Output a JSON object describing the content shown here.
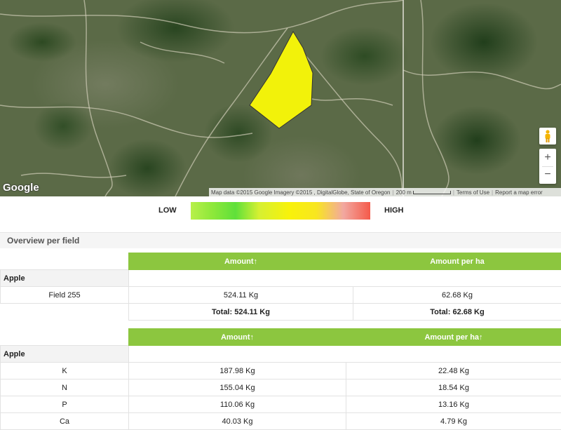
{
  "map": {
    "logo": "Google",
    "attribution": {
      "data": "Map data ©2015 Google Imagery ©2015 , DigitalGlobe, State of Oregon",
      "scale": "200 m",
      "terms": "Terms of Use",
      "report": "Report a map error"
    },
    "controls": {
      "zoom_in": "+",
      "zoom_out": "−"
    },
    "field_color": "#f2f20a"
  },
  "legend": {
    "low": "LOW",
    "high": "HIGH"
  },
  "section": {
    "title": "Overview per field"
  },
  "table1": {
    "headers": [
      "Amount↑",
      "Amount per ha"
    ],
    "group": "Apple",
    "rows": [
      {
        "name": "Field 255",
        "amount": "524.11 Kg",
        "per_ha": "62.68 Kg"
      }
    ],
    "total": {
      "amount": "Total: 524.11 Kg",
      "per_ha": "Total: 62.68 Kg"
    }
  },
  "table2": {
    "headers": [
      "Amount↑",
      "Amount per ha↑"
    ],
    "group": "Apple",
    "rows": [
      {
        "name": "K",
        "amount": "187.98 Kg",
        "per_ha": "22.48 Kg"
      },
      {
        "name": "N",
        "amount": "155.04 Kg",
        "per_ha": "18.54 Kg"
      },
      {
        "name": "P",
        "amount": "110.06 Kg",
        "per_ha": "13.16 Kg"
      },
      {
        "name": "Ca",
        "amount": "40.03 Kg",
        "per_ha": "4.79 Kg"
      }
    ]
  },
  "colors": {
    "header_green": "#8cc63f"
  }
}
